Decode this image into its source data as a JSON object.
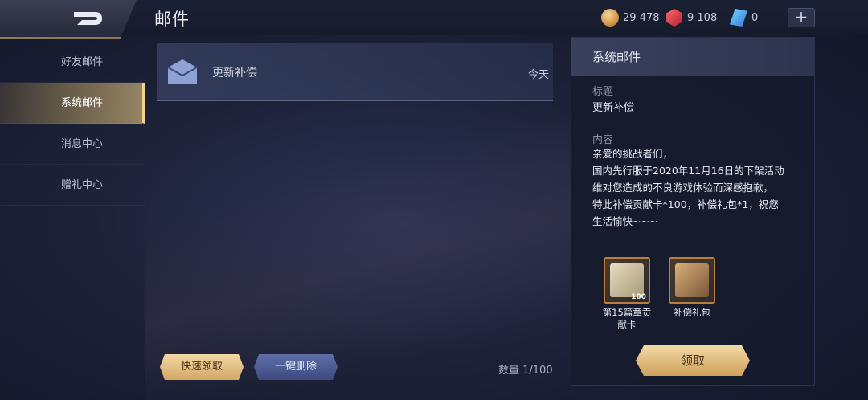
{
  "header": {
    "title": "邮件",
    "currencies": [
      {
        "icon": "gold-coin-icon",
        "value": "29 478"
      },
      {
        "icon": "red-gem-icon",
        "value": "9 108"
      },
      {
        "icon": "blue-crystal-icon",
        "value": "0"
      }
    ],
    "plus_label": "+"
  },
  "sidebar": {
    "items": [
      {
        "label": "好友邮件"
      },
      {
        "label": "系统邮件"
      },
      {
        "label": "消息中心"
      },
      {
        "label": "赠礼中心"
      }
    ],
    "active_index": 1
  },
  "mail_list": {
    "items": [
      {
        "icon": "envelope-icon",
        "subject": "更新补偿",
        "date": "今天"
      }
    ],
    "quick_claim_label": "快速领取",
    "delete_all_label": "一键删除",
    "count_text": "数量 1/100"
  },
  "detail": {
    "header": "系统邮件",
    "subject_label": "标题",
    "subject": "更新补偿",
    "content_label": "内容",
    "content_lines": [
      "亲爱的挑战者们，",
      "国内先行服于2020年11月16日的下架活动",
      "维对您造成的不良游戏体验而深感抱歉，",
      "特此补偿贡献卡*100，补偿礼包*1，祝您",
      "生活愉快~~~"
    ],
    "attachments": [
      {
        "name": "第15篇章贡献卡",
        "qty": "100",
        "icon": "contribution-card-icon"
      },
      {
        "name": "补偿礼包",
        "qty": "",
        "icon": "gift-pack-icon"
      }
    ],
    "claim_label": "领取"
  },
  "colors": {
    "accent_gold": "#d1a866",
    "active_tab": "#f1d48a",
    "background": "#1c2238"
  }
}
